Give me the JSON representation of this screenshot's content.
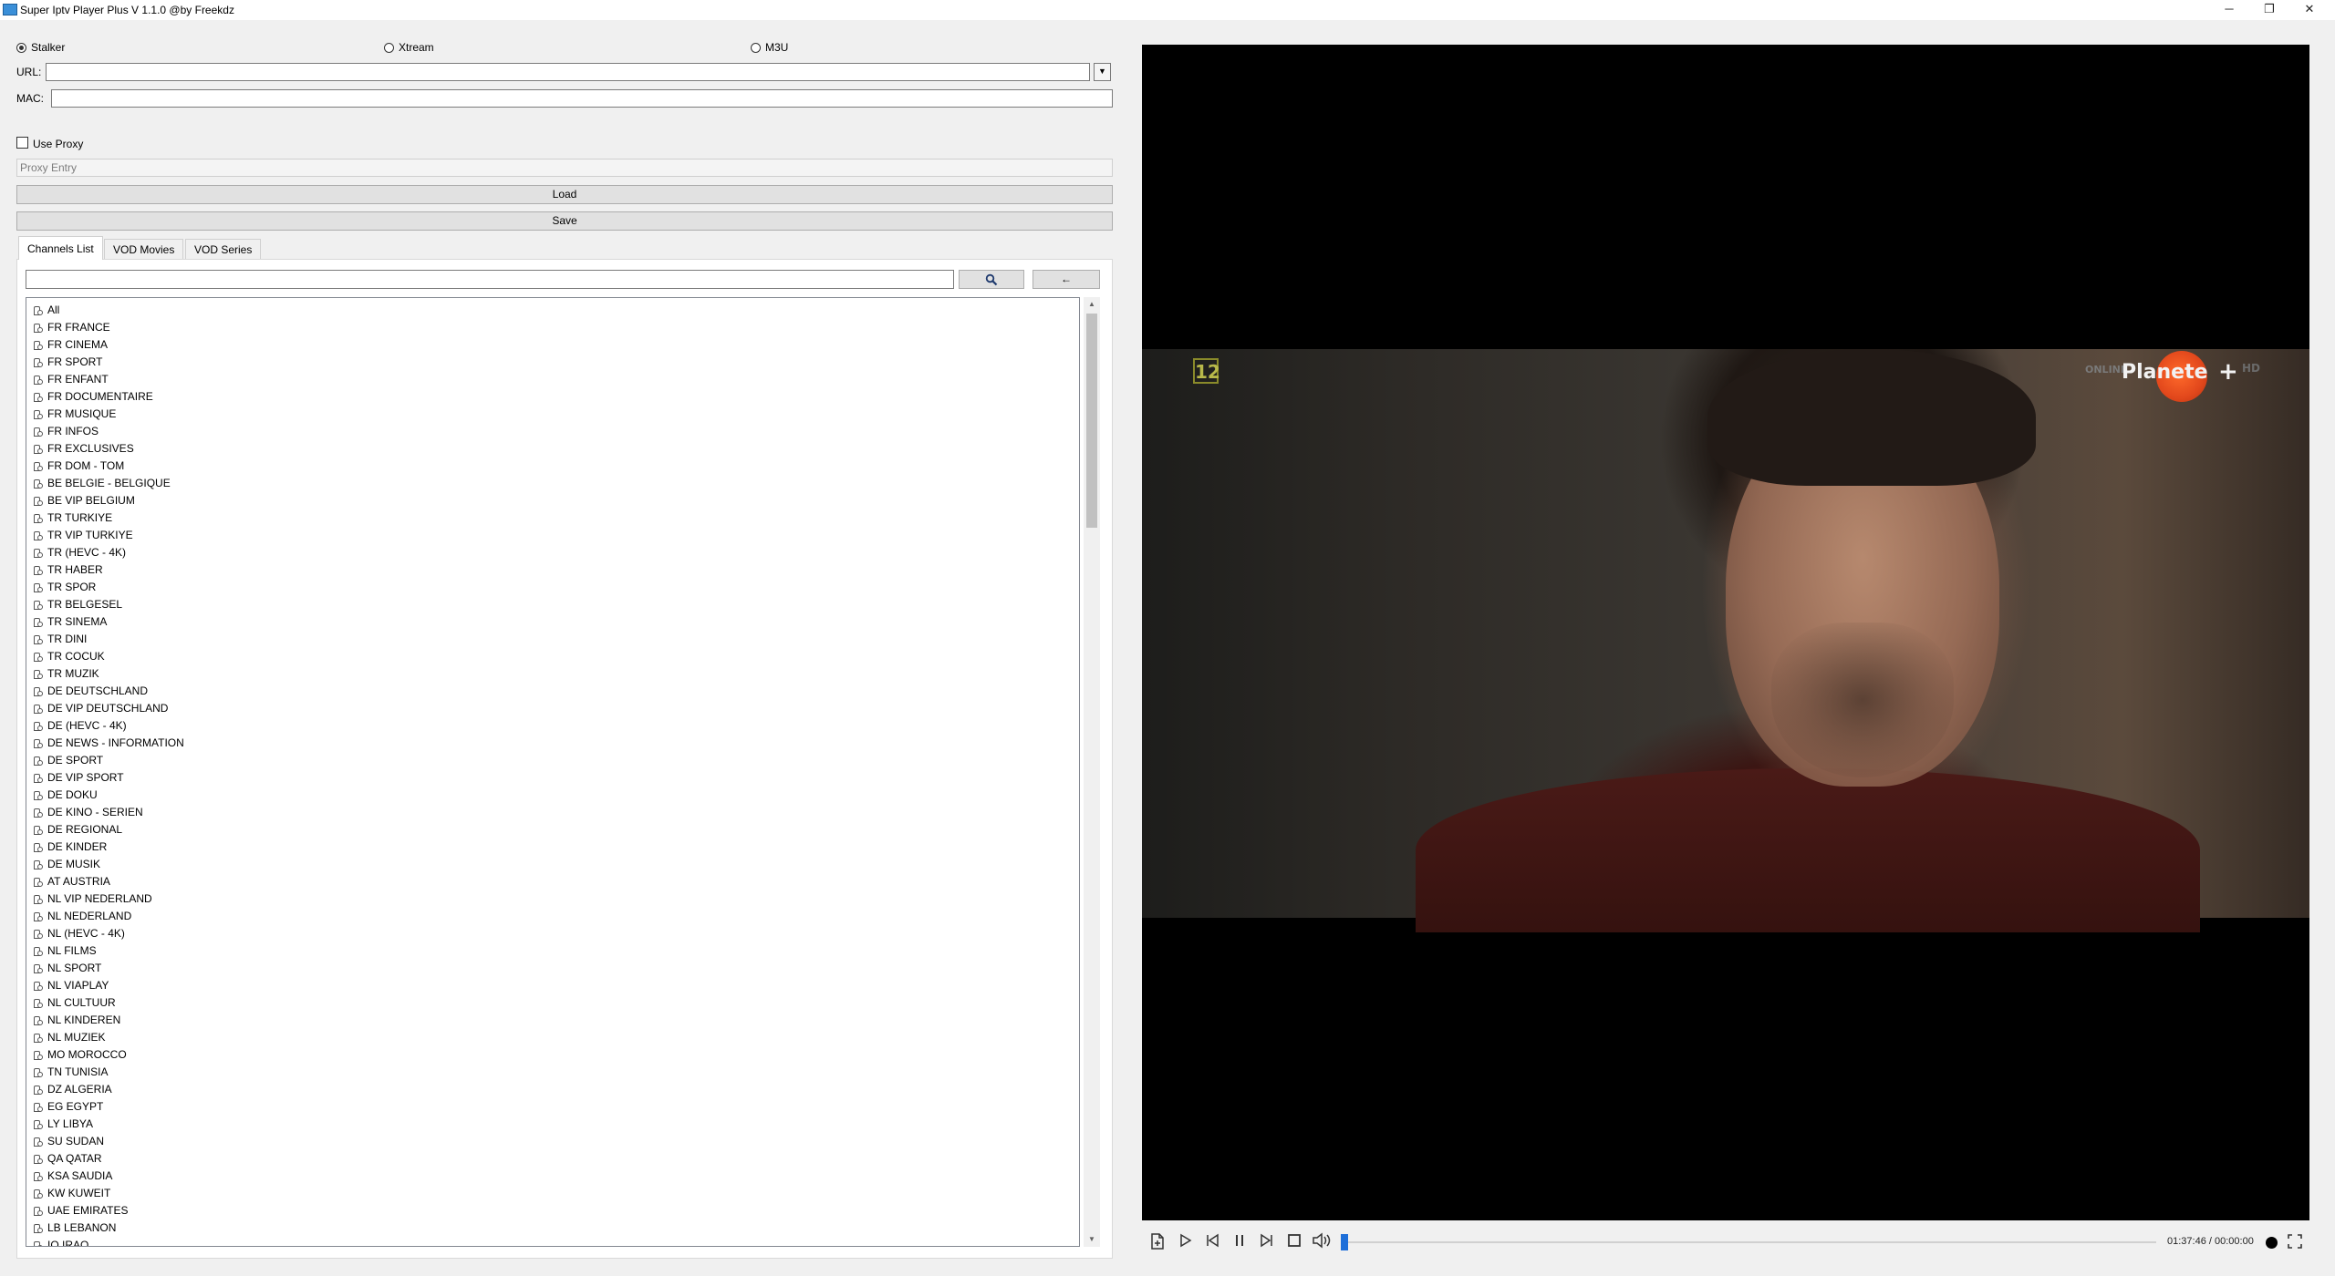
{
  "window": {
    "title": "Super Iptv Player Plus V 1.1.0 @by Freekdz",
    "minimize": "─",
    "restore": "❐",
    "close": "✕"
  },
  "source_mode": {
    "options": [
      "Stalker",
      "Xtream",
      "M3U"
    ],
    "selected": "Stalker"
  },
  "url": {
    "label": "URL:",
    "value": ""
  },
  "mac": {
    "label": "MAC:",
    "value": ""
  },
  "proxy": {
    "checkbox_label": "Use Proxy",
    "checked": false,
    "placeholder": "Proxy Entry"
  },
  "buttons": {
    "load": "Load",
    "save": "Save"
  },
  "tabs": [
    {
      "label": "Channels List",
      "active": true
    },
    {
      "label": "VOD Movies",
      "active": false
    },
    {
      "label": "VOD Series",
      "active": false
    }
  ],
  "search": {
    "value": "",
    "search_icon": "search-icon",
    "back_label": "←"
  },
  "channel_groups": [
    "All",
    "FR FRANCE",
    "FR CINEMA",
    "FR SPORT",
    "FR ENFANT",
    "FR DOCUMENTAIRE",
    "FR MUSIQUE",
    "FR INFOS",
    "FR EXCLUSIVES",
    "FR DOM - TOM",
    "BE BELGIE - BELGIQUE",
    "BE VIP BELGIUM",
    "TR TURKIYE",
    "TR VIP TURKIYE",
    "TR (HEVC - 4K)",
    "TR HABER",
    "TR SPOR",
    "TR BELGESEL",
    "TR SINEMA",
    "TR DINI",
    "TR COCUK",
    "TR MUZIK",
    "DE DEUTSCHLAND",
    "DE VIP DEUTSCHLAND",
    "DE (HEVC - 4K)",
    "DE NEWS - INFORMATION",
    "DE SPORT",
    "DE VIP SPORT",
    "DE DOKU",
    "DE KINO - SERIEN",
    "DE REGIONAL",
    "DE KINDER",
    "DE MUSIK",
    "AT AUSTRIA",
    "NL VIP NEDERLAND",
    "NL NEDERLAND",
    "NL (HEVC - 4K)",
    "NL FILMS",
    "NL SPORT",
    "NL VIAPLAY",
    "NL CULTUUR",
    "NL KINDEREN",
    "NL MUZIEK",
    "MO MOROCCO",
    "TN TUNISIA",
    "DZ ALGERIA",
    "EG EGYPT",
    "LY LIBYA",
    "SU SUDAN",
    "QA QATAR",
    "KSA SAUDIA",
    "KW KUWEIT",
    "UAE EMIRATES",
    "LB LEBANON",
    "IQ IRAQ"
  ],
  "video": {
    "rating_badge": "12",
    "overlay_online": "ONLINE",
    "overlay_brand": "Planete",
    "overlay_plus": "+",
    "overlay_hd": "HD"
  },
  "player": {
    "time": "01:37:46 / 00:00:00",
    "progress": 0.0,
    "icons": [
      "open-file-icon",
      "play-icon",
      "previous-icon",
      "pause-icon",
      "next-icon",
      "stop-icon",
      "volume-icon",
      "record-dot-icon",
      "fullscreen-icon"
    ]
  }
}
